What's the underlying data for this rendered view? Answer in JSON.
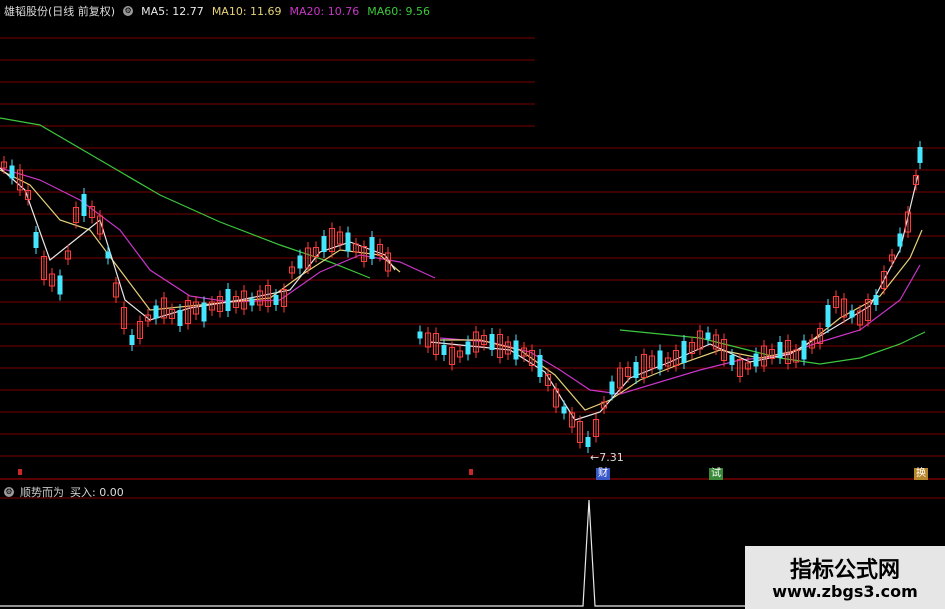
{
  "header": {
    "title": "雄韬股份(日线 前复权)",
    "ma5": "MA5: 12.77",
    "ma10": "MA10: 11.69",
    "ma20": "MA20: 10.76",
    "ma60": "MA60: 9.56"
  },
  "indicator": {
    "name": "顺势而为",
    "value": "买入: 0.00"
  },
  "markers": {
    "low_price": "←7.31",
    "tag_a": "财",
    "tag_b": "试",
    "tag_c": "换"
  },
  "watermark": {
    "line1": "指标公式网",
    "line2": "www.zbgs3.com"
  },
  "colors": {
    "up": "#ff3c3c",
    "down": "#46e6ff",
    "ma5": "#e8e8e8",
    "ma10": "#e6d27a",
    "ma20": "#c836c8",
    "ma60": "#3cc83c",
    "grid": "#7a0000"
  }
}
